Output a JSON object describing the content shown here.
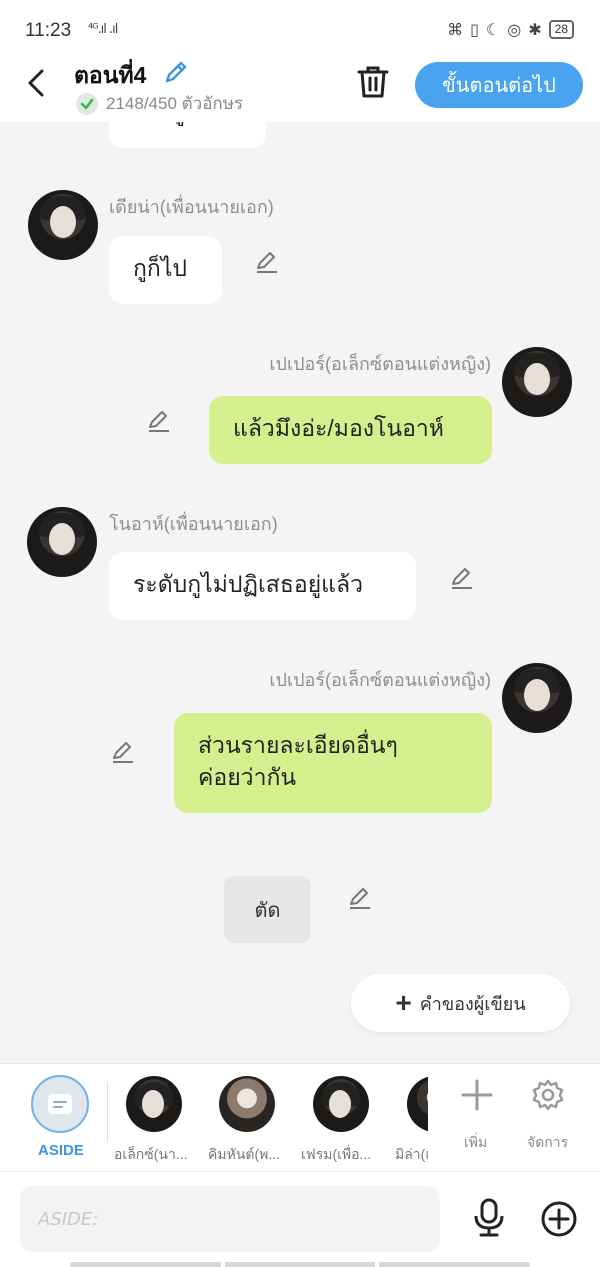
{
  "status_bar": {
    "time": "11:23",
    "signal": "⁴ᴳ.ıl .ıl",
    "battery": "28"
  },
  "header": {
    "title": "ตอนที่4",
    "char_count": "2148/450 ตัวอักษร",
    "next_label": "ขั้นตอนต่อไป"
  },
  "messages": [
    {
      "name": "",
      "text": "เชยดูแล้ว",
      "side": "left"
    },
    {
      "name": "เดียน่า(เพื่อนนายเอก)",
      "text": "กูก็ไป",
      "side": "left"
    },
    {
      "name": "เปเปอร์(อเล็กซ์ตอนแต่งหญิง)",
      "text": "แล้วมึงอ่ะ/มองโนอาห์",
      "side": "right"
    },
    {
      "name": "โนอาห์(เพื่อนนายเอก)",
      "text": "ระดับกูไม่ปฏิเสธอยู่แล้ว",
      "side": "left"
    },
    {
      "name": "เปเปอร์(อเล็กซ์ตอนแต่งหญิง)",
      "text": "ส่วนรายละเอียดอื่นๆ\nค่อยว่ากัน",
      "side": "right"
    }
  ],
  "cut_label": "ตัด",
  "writer_button": {
    "label": "คำของผู้เขียน"
  },
  "character_bar": {
    "aside_label": "ASIDE",
    "characters": [
      {
        "label": "อเล็กซ์(นา..."
      },
      {
        "label": "คิมหันต์(พ..."
      },
      {
        "label": "เฟรม(เพื่อ..."
      },
      {
        "label": "มิล่า(เ"
      }
    ],
    "add_label": "เพิ่ม",
    "manage_label": "จัดการ"
  },
  "input": {
    "placeholder": "ASIDE:"
  },
  "colors": {
    "accent": "#4aa3f0",
    "green_bubble": "#d6ef8e",
    "background": "#f4f4f4"
  }
}
